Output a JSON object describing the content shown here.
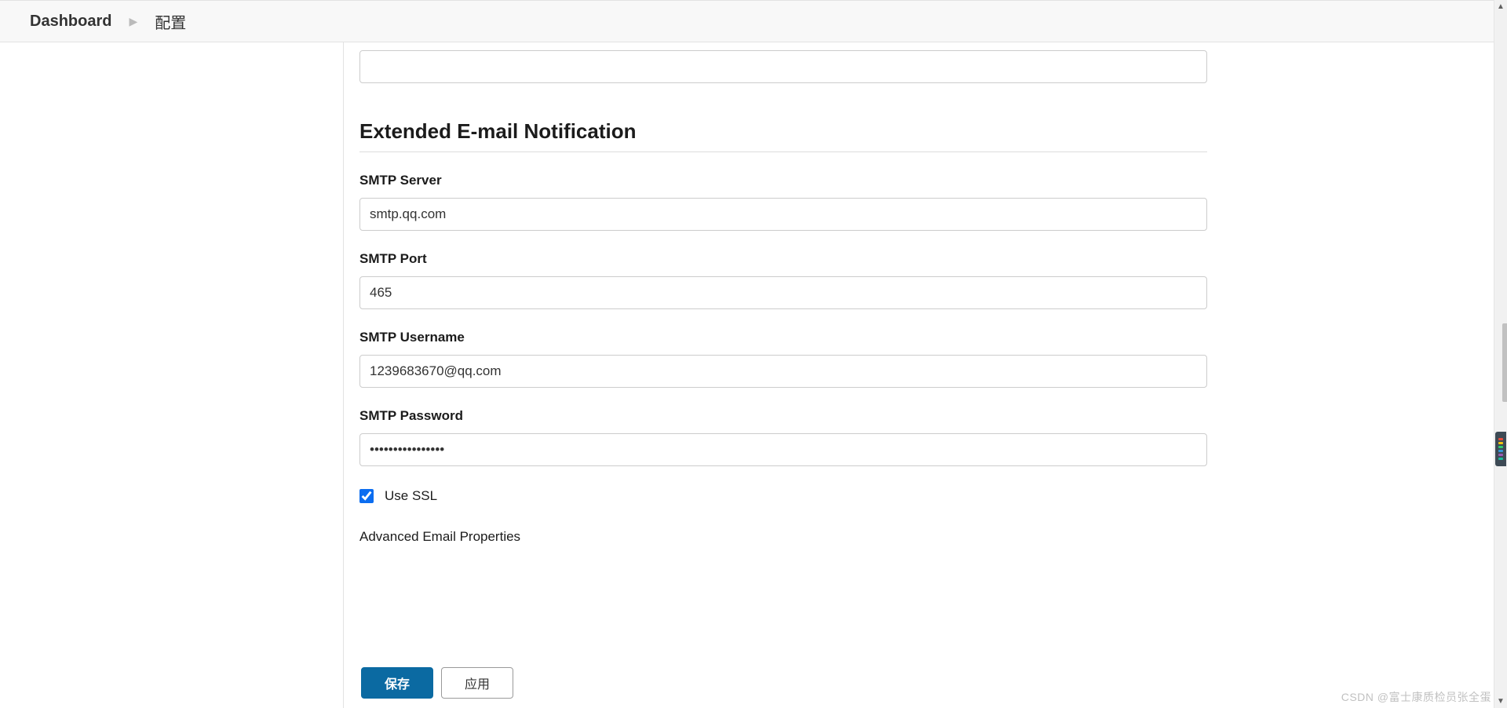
{
  "breadcrumb": {
    "root": "Dashboard",
    "current": "配置"
  },
  "form": {
    "top_field_value": "",
    "section_heading": "Extended E-mail Notification",
    "smtp_server": {
      "label": "SMTP Server",
      "value": "smtp.qq.com"
    },
    "smtp_port": {
      "label": "SMTP Port",
      "value": "465"
    },
    "smtp_username": {
      "label": "SMTP Username",
      "value": "1239683670@qq.com"
    },
    "smtp_password": {
      "label": "SMTP Password",
      "value": "••••••••••••••••"
    },
    "use_ssl": {
      "label": "Use SSL",
      "checked": true
    },
    "advanced_label": "Advanced Email Properties"
  },
  "buttons": {
    "save": "保存",
    "apply": "应用"
  },
  "watermark": "CSDN @富士康质检员张全蛋"
}
